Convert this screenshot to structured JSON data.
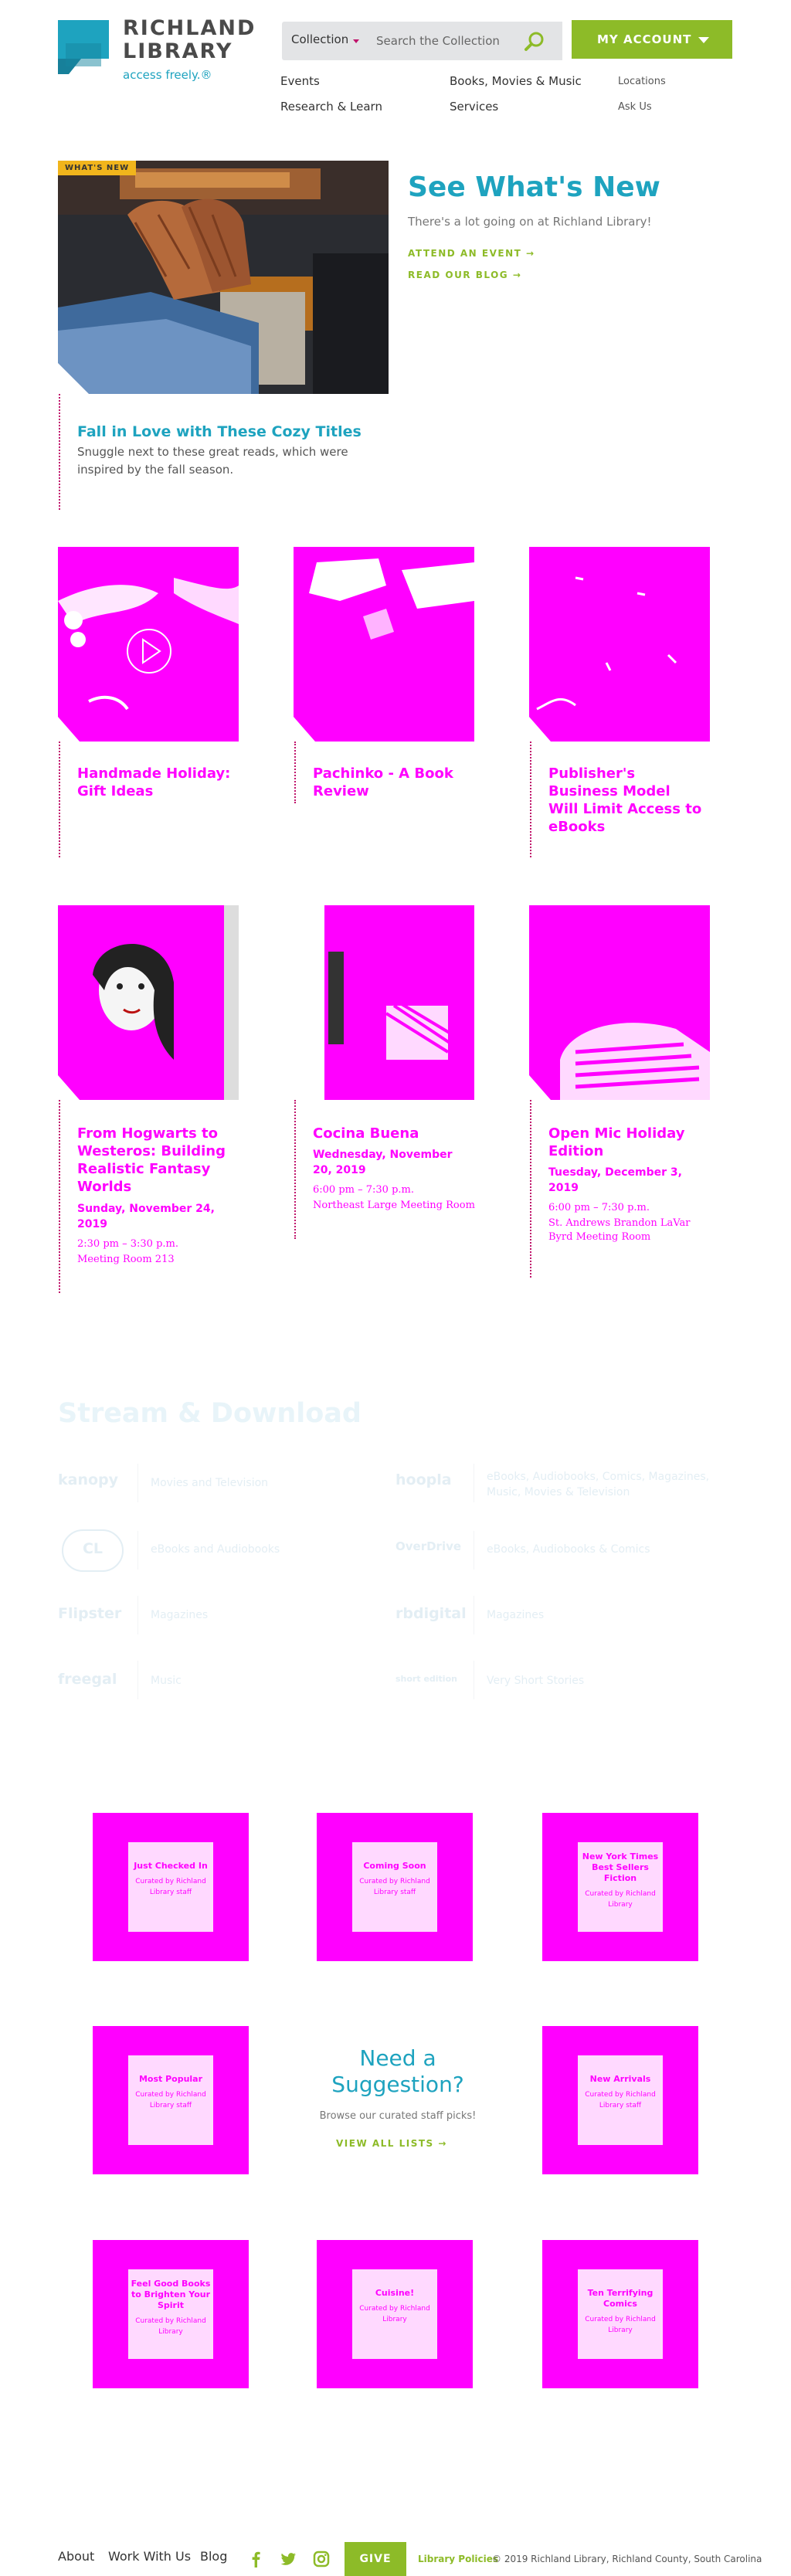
{
  "header": {
    "logo_line1": "RICHLAND",
    "logo_line2": "LIBRARY",
    "tagline": "access freely.®",
    "search_scope": "Collection",
    "search_placeholder": "Search the Collection",
    "account_label": "MY ACCOUNT",
    "nav": {
      "events": "Events",
      "books": "Books, Movies & Music",
      "research": "Research & Learn",
      "services": "Services",
      "locations": "Locations",
      "ask": "Ask Us"
    }
  },
  "featured": {
    "badge": "WHAT'S NEW",
    "title": "Fall in Love with These Cozy Titles",
    "description": "Snuggle next to these great reads, which were inspired by the fall season.",
    "heading": "See What's New",
    "subheading": "There's a lot going on at Richland Library!",
    "attend": "ATTEND AN EVENT",
    "blog": "READ OUR BLOG"
  },
  "cards_row1": [
    {
      "title": "Handmade Holiday: Gift Ideas"
    },
    {
      "title": "Pachinko - A Book Review"
    },
    {
      "title": "Publisher's Business Model Will Limit Access to eBooks"
    }
  ],
  "cards_row2": [
    {
      "title": "From Hogwarts to Westeros: Building Realistic Fantasy Worlds",
      "date": "Sunday, November 24, 2019",
      "time": "2:30 pm – 3:30 p.m.",
      "room": "Meeting Room 213"
    },
    {
      "title": "Cocina Buena",
      "date": "Wednesday, November 20, 2019",
      "time": "6:00 pm – 7:30 p.m.",
      "room": "Northeast Large Meeting Room"
    },
    {
      "title": "Open Mic Holiday Edition",
      "date": "Tuesday, December 3, 2019",
      "time": "6:00 pm – 7:30 p.m.",
      "room": "St. Andrews Brandon LaVar Byrd Meeting Room"
    }
  ],
  "stream": {
    "title": "Stream & Download",
    "services": [
      {
        "logo": "kanopy",
        "desc": "Movies and Television"
      },
      {
        "logo": "hoopla",
        "desc": "eBooks, Audiobooks, Comics, Magazines, Music, Movies & Television"
      },
      {
        "logo": "CL",
        "desc": "eBooks and Audiobooks"
      },
      {
        "logo": "OverDrive",
        "desc": "eBooks, Audiobooks & Comics"
      },
      {
        "logo": "Flipster",
        "desc": "Magazines"
      },
      {
        "logo": "rbdigital",
        "desc": "Magazines"
      },
      {
        "logo": "freegal",
        "desc": "Music"
      },
      {
        "logo": "short edition",
        "desc": "Very Short Stories"
      }
    ]
  },
  "lists": {
    "tiles": [
      {
        "label": "Just Checked In",
        "byline": "Curated by Richland Library staff"
      },
      {
        "label": "Coming Soon",
        "byline": "Curated by Richland Library staff"
      },
      {
        "label": "New York Times Best Sellers Fiction",
        "byline": "Curated by Richland Library"
      },
      {
        "label": "Most Popular",
        "byline": "Curated by Richland Library staff"
      },
      {
        "label": "New Arrivals",
        "byline": "Curated by Richland Library staff"
      },
      {
        "label": "Feel Good Books to Brighten Your Spirit",
        "byline": "Curated by Richland Library"
      },
      {
        "label": "Cuisine!",
        "byline": "Curated by Richland Library"
      },
      {
        "label": "Ten Terrifying Comics",
        "byline": "Curated by Richland Library"
      }
    ],
    "need_title": "Need a Suggestion?",
    "need_sub": "Browse our curated staff picks!",
    "view_all": "VIEW ALL LISTS"
  },
  "footer": {
    "about": "About",
    "work": "Work With Us",
    "blog": "Blog",
    "give": "GIVE",
    "policies": "Library Policies",
    "copyright": "© 2019 Richland Library, Richland County, South Carolina"
  },
  "colors": {
    "brand_teal": "#1ea3bf",
    "brand_green": "#8dbb28",
    "placeholder_magenta": "#ff00ff",
    "badge_yellow": "#f1b51c"
  }
}
